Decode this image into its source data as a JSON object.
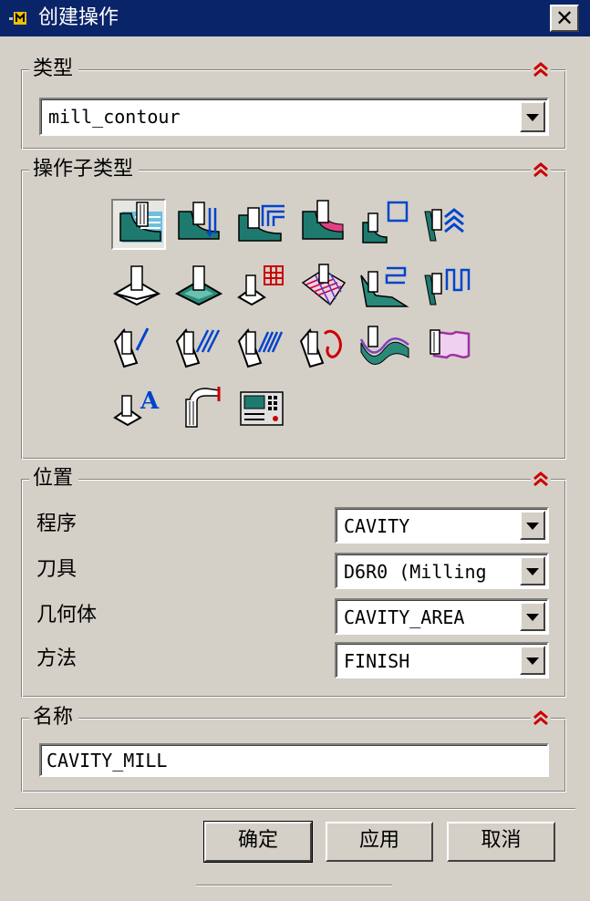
{
  "title": "创建操作",
  "colors": {
    "titlebar": "#0a246a",
    "collapse_icon": "#cc0000",
    "face": "#d4d0c8"
  },
  "type_group": {
    "label": "类型",
    "combo_value": "mill_contour"
  },
  "subtype_group": {
    "label": "操作子类型",
    "icons": [
      {
        "name": "cavity-mill-icon",
        "selected": true
      },
      {
        "name": "plunge-milling-icon"
      },
      {
        "name": "corner-rough-icon"
      },
      {
        "name": "rest-milling-icon"
      },
      {
        "name": "zlevel-profile-icon"
      },
      {
        "name": "zlevel-corner-icon"
      },
      {
        "name": "fixed-contour-icon"
      },
      {
        "name": "contour-area-icon"
      },
      {
        "name": "contour-surface-area-icon"
      },
      {
        "name": "streamline-icon"
      },
      {
        "name": "contour-area-non-steep-icon"
      },
      {
        "name": "contour-area-dir-steep-icon"
      },
      {
        "name": "flowcut-single-icon"
      },
      {
        "name": "flowcut-multiple-icon"
      },
      {
        "name": "flowcut-ref-tool-icon"
      },
      {
        "name": "flowcut-smooth-icon"
      },
      {
        "name": "contour-profile-icon"
      },
      {
        "name": "solid-profile-3d-icon"
      },
      {
        "name": "contour-text-icon"
      },
      {
        "name": "mill-user-icon"
      },
      {
        "name": "mill-control-icon"
      }
    ]
  },
  "location_group": {
    "label": "位置",
    "fields": [
      {
        "label": "程序",
        "value": "CAVITY"
      },
      {
        "label": "刀具",
        "value": "D6R0 (Milling"
      },
      {
        "label": "几何体",
        "value": "CAVITY_AREA"
      },
      {
        "label": "方法",
        "value": "FINISH"
      }
    ]
  },
  "name_group": {
    "label": "名称",
    "value": "CAVITY_MILL"
  },
  "buttons": {
    "ok": "确定",
    "apply": "应用",
    "cancel": "取消"
  }
}
